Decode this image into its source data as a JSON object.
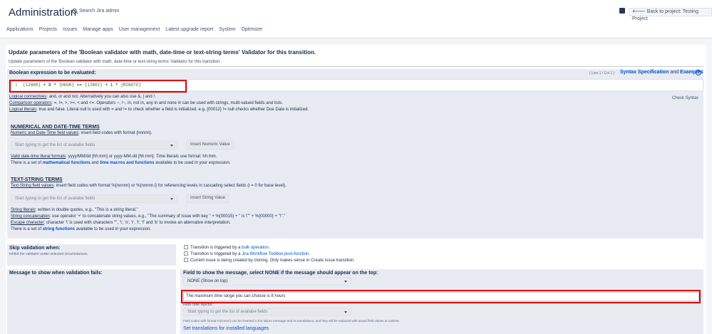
{
  "header": {
    "title": "Administration",
    "search_placeholder": "Search Jira admin",
    "back_button": "Back to project: Testing Project"
  },
  "nav": [
    "Applications",
    "Projects",
    "Issues",
    "Manage apps",
    "User management",
    "Latest upgrade report",
    "System",
    "Optimizer"
  ],
  "page": {
    "title": "Update parameters of the 'Boolean validator with math, date-time or text-string terms' Validator for this transition.",
    "subtitle": "Update parameters of the 'Boolean validator with math, date-time or text-string terms' Validator for this transition."
  },
  "expression": {
    "label": "Boolean expression to be evaluated:",
    "line_col": "[ Line 1 / Col 1 ]",
    "syntax_spec": "Syntax Specification",
    "and": "and",
    "examples": "Examples",
    "line_number": "1",
    "code_a": "{12800}",
    "code_b": " + 8 * ",
    "code_c": "{HOUR}",
    "code_d": " >= ",
    "code_e": "{12801}",
    "code_f": " + 1 * ",
    "code_g": "{MINUTE}",
    "check_syntax": "Check Syntax"
  },
  "help": {
    "logical_connectives_label": "Logical connectives",
    "logical_connectives_text": ": and, or and not. Alternatively you can also use &, | and !.",
    "comparison_label": "Comparison operators",
    "comparison_text": ": =, !=, >, >=, < and <=. Operators ~, !~, in, not in, any in and none in can be used with strings, multi-valued fields and lists.",
    "literals_label": "Logical literals",
    "literals_text": ": true and false. Literal null is used with = and != to check whether a field is initialized, e.g. {00012} != null checks whether Due Date is initialized."
  },
  "numeric": {
    "title": "NUMERICAL AND DATE-TIME TERMS",
    "desc_label": "Numeric and Date-Time field values",
    "desc_text": ": insert field codes with format {nnnnn}.",
    "select_placeholder": "Start typing to get the list of availabe fields",
    "button": "Insert Numeric Value",
    "valid_label": "Valid date-time literal formats",
    "valid_text": ": yyyy/MM/dd [hh:mm] or yyyy-MM-dd [hh:mm]. Time literals use format: hh:mm.",
    "set_pre": "There is a set of ",
    "math_link": "mathematical functions",
    "and": " and ",
    "time_link": "time macros and functions",
    "set_post": " available to be used in your expression."
  },
  "text": {
    "title": "TEXT-STRING TERMS",
    "desc_label": "Text-String field values",
    "desc_text": ": insert field codes with format %{nnnnn} or %{nnnnn.i} for referencing levels in cascading select fields (i = 0 for base level).",
    "select_placeholder": "Start typing to get the list of availabe fields",
    "button": "Insert String Value",
    "literals_label": "String literals",
    "literals_text": ": written in double quotes, e.g., \"This is a string literal.\"",
    "concat_label": "String concatenation",
    "concat_text": ": use operator '+' to concatenate string values, e.g., \"The summary of issue with key \" + %{00015} + \" is \\\"\" + %{00000} + \"\\\".\"",
    "escape_label": "Escape character",
    "escape_text": ": character '\\' is used with characters '\"', '\\', 'n', 'r', 't', 'f' and 'b' to invoke an alternative interpretation.",
    "set_pre": "There is a set of ",
    "string_link": "string functions",
    "set_post": " available to be used in your expression."
  },
  "skip": {
    "label": "Skip validation when:",
    "desc": "Inhibit the validator under selected circumstances.",
    "opt1_pre": "Transition is triggered by a ",
    "opt1_link": "bulk operation",
    "opt2_pre": "Transition is triggered by a ",
    "opt2_link": "Jira Workflow Toolbox post-function",
    "opt3": "Current issue is being created by cloning. Only makes sense in Create Issue transition."
  },
  "message": {
    "label": "Message to show when validation fails:",
    "field_label": "Field to show the message, select NONE if the message should appear on the top:",
    "field_value": "NONE (Show on top)",
    "message_value": "The maximum time range you can choose is 8 hours",
    "injector_label": "Field code injector:",
    "injector_placeholder": "Start typing to get the list of availabe fields",
    "note": "Field codes with format %{nnnnn} can be inserted in the failure message and its translations, and they will be replaced with actual field values at runtime.",
    "translations_link": "Set translations for installed languages"
  }
}
